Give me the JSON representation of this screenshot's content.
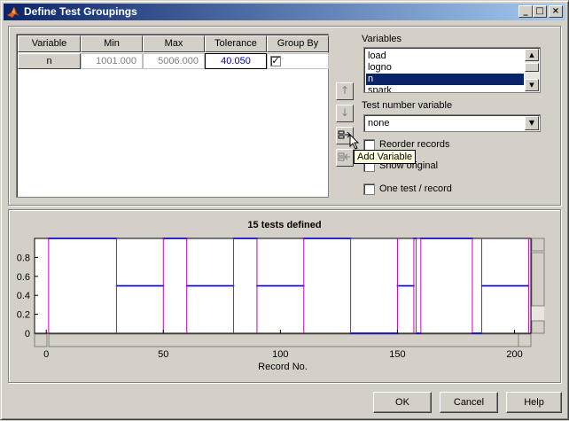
{
  "window": {
    "title": "Define Test Groupings"
  },
  "grid": {
    "columns": [
      "Variable",
      "Min",
      "Max",
      "Tolerance",
      "Group By"
    ],
    "rows": [
      {
        "variable": "n",
        "min": "1001.000",
        "max": "5006.000",
        "tolerance": "40.050",
        "group_by": true
      }
    ]
  },
  "variables": {
    "label": "Variables",
    "items": [
      "load",
      "logno",
      "n",
      "spark"
    ],
    "selected": "n"
  },
  "test_number": {
    "label": "Test number variable",
    "value": "none"
  },
  "options": {
    "reorder_label": "Reorder records",
    "show_original_label": "Show original",
    "one_test_label": "One test / record"
  },
  "tooltip": {
    "text": "Add Variable"
  },
  "buttons": {
    "ok": "OK",
    "cancel": "Cancel",
    "help": "Help"
  },
  "colors": {
    "boundary": "#c000c0",
    "data": "#0000c0"
  },
  "chart_data": {
    "type": "line",
    "title": "15 tests defined",
    "xlabel": "Record No.",
    "ylabel": "",
    "xlim": [
      -5,
      207
    ],
    "ylim": [
      0,
      1
    ],
    "x_ticks": [
      0,
      50,
      100,
      150,
      200
    ],
    "y_ticks": [
      0,
      0.2,
      0.4,
      0.6,
      0.8
    ],
    "x_tick_labels": [
      "0",
      "50",
      "100",
      "150",
      "200"
    ],
    "y_tick_labels": [
      "0",
      "0.2",
      "0.4",
      "0.6",
      "0.8"
    ],
    "grid": false,
    "test_boundaries": [
      1,
      30,
      50,
      60,
      80,
      90,
      110,
      130,
      150,
      157,
      158,
      160,
      182,
      186,
      206
    ],
    "segments": [
      {
        "x_start": 1,
        "x_end": 30,
        "y": 1
      },
      {
        "x_start": 30,
        "x_end": 50,
        "y": 0.5
      },
      {
        "x_start": 50,
        "x_end": 60,
        "y": 1
      },
      {
        "x_start": 60,
        "x_end": 80,
        "y": 0.5
      },
      {
        "x_start": 80,
        "x_end": 90,
        "y": 1
      },
      {
        "x_start": 90,
        "x_end": 110,
        "y": 0.5
      },
      {
        "x_start": 110,
        "x_end": 130,
        "y": 1
      },
      {
        "x_start": 130,
        "x_end": 150,
        "y": 0
      },
      {
        "x_start": 150,
        "x_end": 157,
        "y": 0.5
      },
      {
        "x_start": 157,
        "x_end": 158,
        "y": 1
      },
      {
        "x_start": 158,
        "x_end": 160,
        "y": 0
      },
      {
        "x_start": 160,
        "x_end": 182,
        "y": 1
      },
      {
        "x_start": 182,
        "x_end": 186,
        "y": 0
      },
      {
        "x_start": 186,
        "x_end": 206,
        "y": 0.5
      }
    ]
  }
}
